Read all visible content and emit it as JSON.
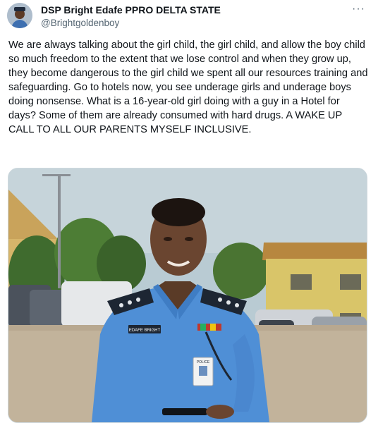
{
  "author": {
    "display_name": "DSP Bright Edafe PPRO DELTA STATE",
    "handle": "@Brightgoldenboy",
    "avatar_icon": "profile-photo"
  },
  "menu": {
    "more_icon": "more-horizontal-icon",
    "more_label": "···"
  },
  "tweet": {
    "text": "We are always talking about the girl child, the girl child, and allow the boy child so much freedom to the extent that we lose control and when they grow up, they become dangerous to the girl child we spent all our resources training and safeguarding. Go to hotels now, you see underage girls and underage boys doing nonsense. What is a 16-year-old girl doing with a guy in a Hotel for days? Some of them are already consumed with hard drugs. A WAKE UP CALL TO ALL OUR PARENTS MYSELF INCLUSIVE."
  },
  "photo": {
    "name_tag": "EDAFE BRIGHT",
    "id_card_label": "POLICE"
  },
  "colors": {
    "text_primary": "#0f1419",
    "text_secondary": "#536471",
    "uniform_blue": "#4f8fd6",
    "sky": "#b9cbd3"
  }
}
